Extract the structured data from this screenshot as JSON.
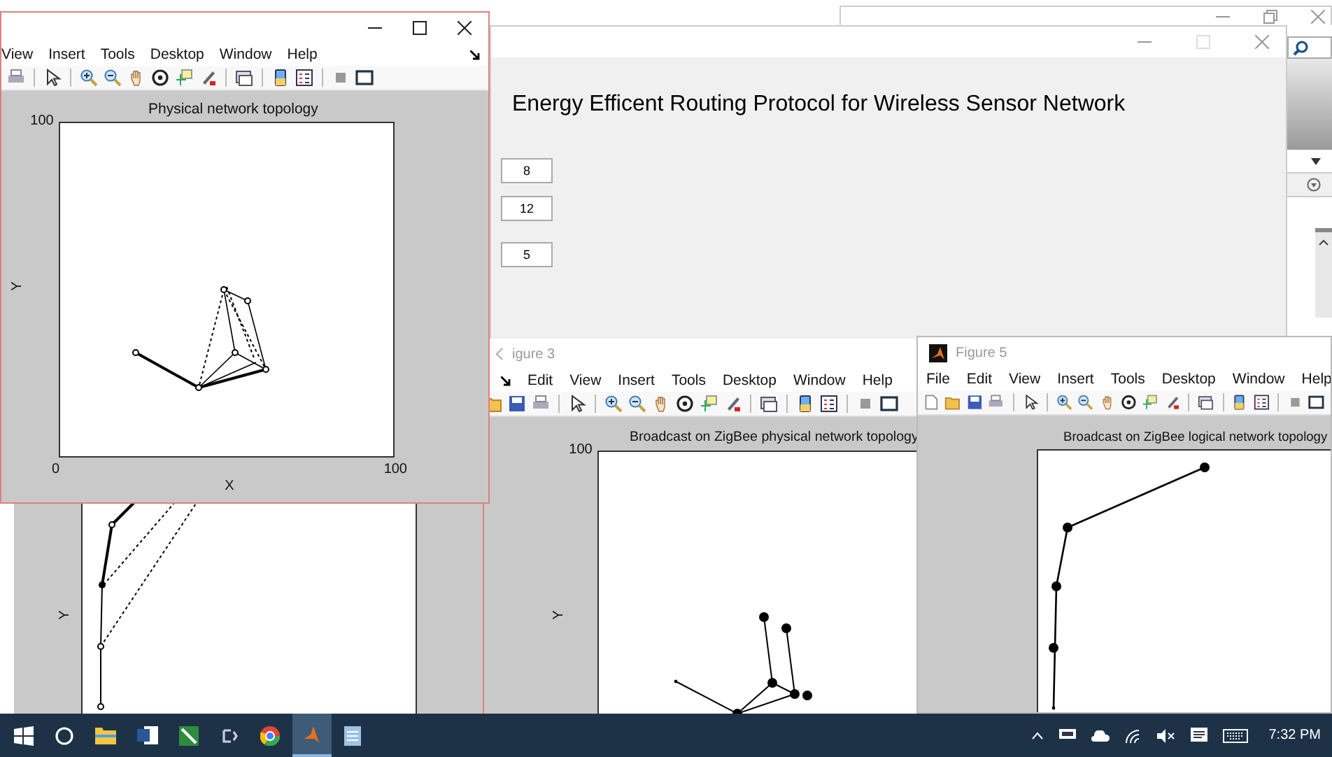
{
  "gui_window": {
    "heading": "Energy Efficent Routing Protocol for Wireless Sensor Network",
    "fields": [
      {
        "value": "8"
      },
      {
        "value": "12"
      },
      {
        "value": "5"
      }
    ]
  },
  "figure_back": {
    "ylabel": "Y"
  },
  "figure_1": {
    "menu": [
      "View",
      "Insert",
      "Tools",
      "Desktop",
      "Window",
      "Help"
    ],
    "axes": {
      "title": "Physical network topology",
      "ytick": "100",
      "xticks": [
        "0",
        "100"
      ],
      "xlabel": "X",
      "ylabel": "Y"
    }
  },
  "figure_3": {
    "title": "igure 3",
    "menu": [
      "Edit",
      "View",
      "Insert",
      "Tools",
      "Desktop",
      "Window",
      "Help"
    ],
    "axes": {
      "title": "Broadcast on ZigBee physical network topology",
      "ytick": "100",
      "ylabel": "Y"
    }
  },
  "figure_5": {
    "title": "Figure 5",
    "menu": [
      "File",
      "Edit",
      "View",
      "Insert",
      "Tools",
      "Desktop",
      "Window",
      "Help"
    ],
    "axes": {
      "title": "Broadcast on ZigBee logical network topology"
    }
  },
  "taskbar": {
    "clock": "7:32 PM"
  }
}
